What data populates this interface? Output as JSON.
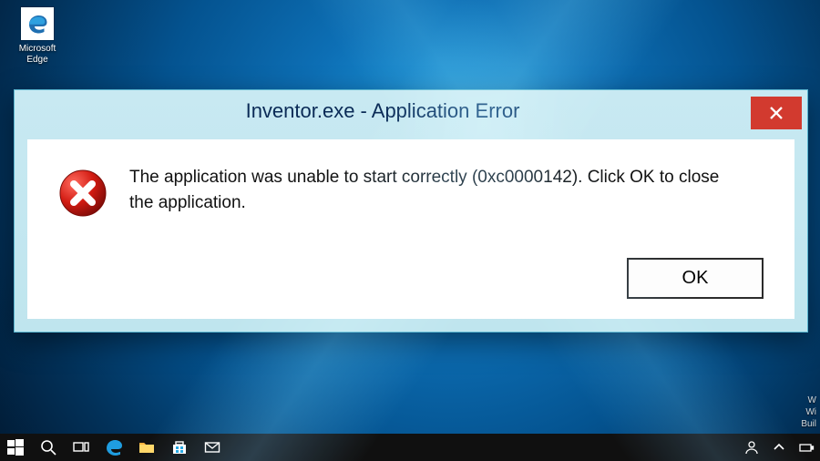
{
  "desktop": {
    "icons": [
      {
        "id": "edge",
        "label": "Microsoft\nEdge"
      }
    ]
  },
  "dialog": {
    "title": "Inventor.exe - Application Error",
    "message": "The application was unable to start correctly (0xc0000142). Click OK to close the application.",
    "ok_label": "OK"
  },
  "watermark": {
    "line1": "W",
    "line2": "Wi",
    "line3": "Buil"
  },
  "taskbar": {
    "items": [
      "start",
      "search",
      "taskview",
      "edge",
      "explorer",
      "store",
      "mail"
    ],
    "tray_text": ""
  },
  "colors": {
    "dialog_chrome": "#c8e9f2",
    "close_button": "#d23a2f",
    "taskbar": "#101010"
  }
}
